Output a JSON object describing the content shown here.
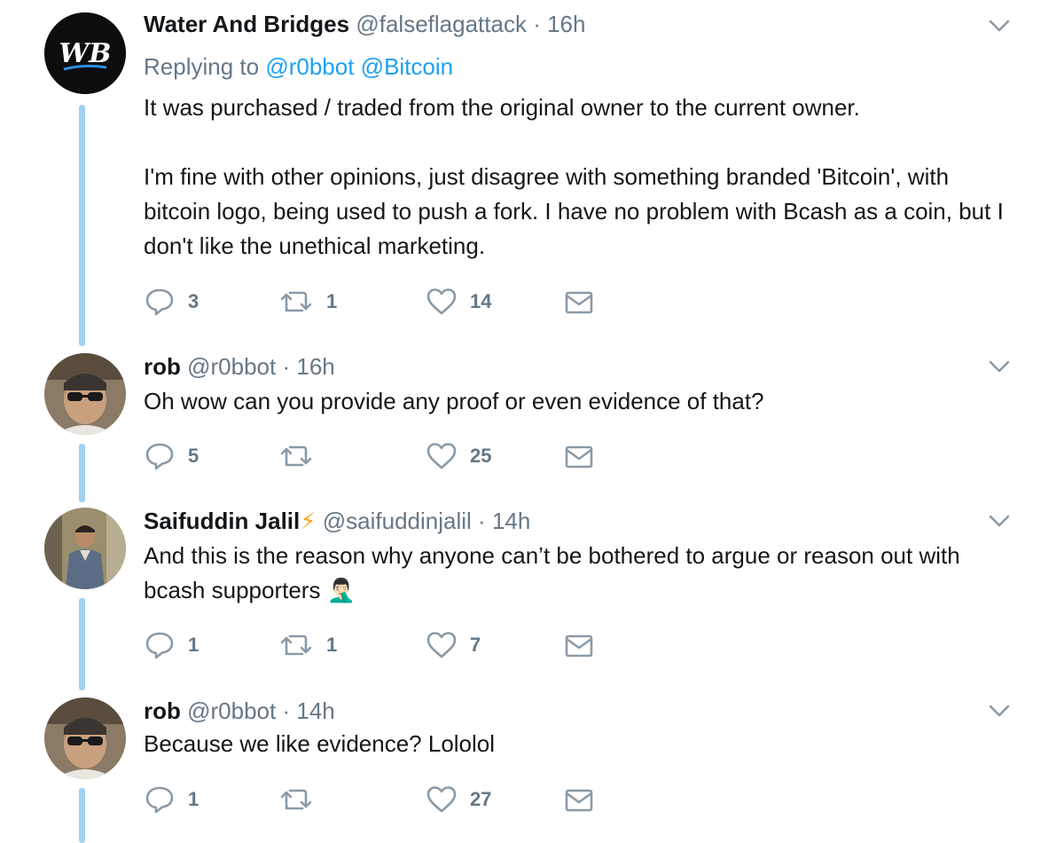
{
  "tweets": [
    {
      "name": "Water And Bridges",
      "handle": "@falseflagattack",
      "sep": "·",
      "time": "16h",
      "replying_prefix": "Replying to",
      "replying_to": [
        "@r0bbot",
        "@Bitcoin"
      ],
      "avatar_text": "WB",
      "text": [
        "It was purchased / traded from the original owner to the current owner.",
        "I'm fine with other opinions, just disagree with something branded 'Bitcoin', with bitcoin logo, being used to push a fork. I have no problem with Bcash as a coin, but I don't like the unethical marketing."
      ],
      "replies": "3",
      "retweets": "1",
      "likes": "14"
    },
    {
      "name": "rob",
      "handle": "@r0bbot",
      "sep": "·",
      "time": "16h",
      "text": [
        "Oh wow can you provide any proof or even evidence of that?"
      ],
      "replies": "5",
      "retweets": "",
      "likes": "25"
    },
    {
      "name": "Saifuddin Jalil",
      "name_emoji": "⚡",
      "handle": "@saifuddinjalil",
      "sep": "·",
      "time": "14h",
      "text": [
        "And this is the reason why anyone can’t be bothered to argue or reason out with bcash supporters 🤦🏻‍♂️"
      ],
      "replies": "1",
      "retweets": "1",
      "likes": "7"
    },
    {
      "name": "rob",
      "handle": "@r0bbot",
      "sep": "·",
      "time": "14h",
      "text": [
        "Because we like evidence? Lololol"
      ],
      "replies": "1",
      "retweets": "",
      "likes": "27"
    }
  ],
  "colors": {
    "thread_line": "#9fd2f3",
    "link": "#1da1f2",
    "muted": "#657786",
    "icon": "#8a9aa8"
  },
  "icons": {
    "reply": "reply-icon",
    "retweet": "retweet-icon",
    "like": "heart-icon",
    "dm": "envelope-icon",
    "more": "chevron-down-icon"
  }
}
